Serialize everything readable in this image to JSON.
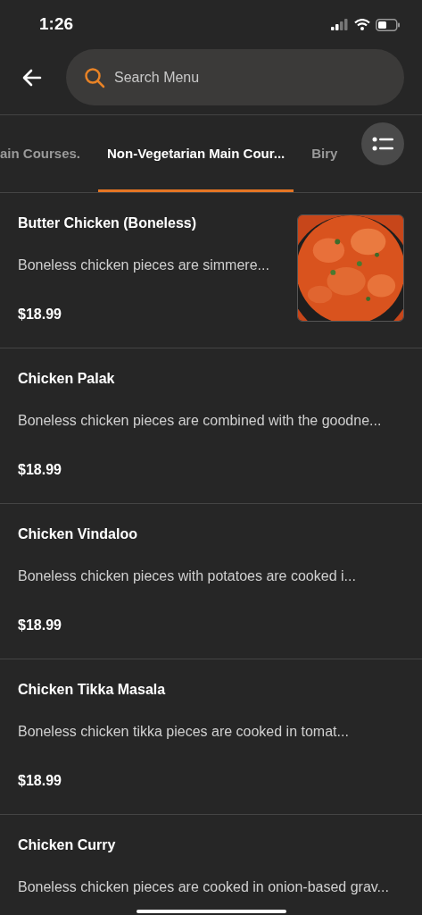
{
  "status_bar": {
    "time": "1:26"
  },
  "search": {
    "placeholder": "Search Menu"
  },
  "tabs": [
    {
      "label": "ain Courses.",
      "selected": false
    },
    {
      "label": "Non-Vegetarian Main Cour...",
      "selected": true
    },
    {
      "label": "Biry",
      "selected": false
    }
  ],
  "items": [
    {
      "name": "Butter Chicken (Boneless)",
      "description": "Boneless chicken pieces are simmere...",
      "price": "$18.99"
    },
    {
      "name": "Chicken Palak",
      "description": "Boneless chicken pieces are combined with the goodne...",
      "price": "$18.99"
    },
    {
      "name": "Chicken Vindaloo",
      "description": "Boneless chicken pieces with potatoes are cooked i...",
      "price": "$18.99"
    },
    {
      "name": "Chicken Tikka Masala",
      "description": "Boneless chicken tikka pieces are cooked in tomat...",
      "price": "$18.99"
    },
    {
      "name": "Chicken Curry",
      "description": "Boneless chicken pieces are cooked in onion-based grav..."
    }
  ]
}
